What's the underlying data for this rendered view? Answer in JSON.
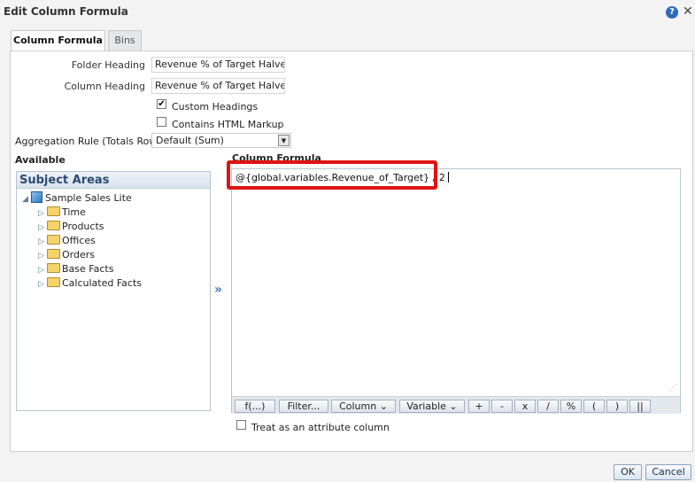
{
  "dialog": {
    "title": "Edit Column Formula"
  },
  "icons": {
    "help": "?",
    "close": "✕"
  },
  "tabs": [
    {
      "label": "Column Formula",
      "active": true
    },
    {
      "label": "Bins",
      "active": false
    }
  ],
  "form": {
    "folder_heading_label": "Folder Heading",
    "folder_heading_value": "Revenue % of Target Halved",
    "column_heading_label": "Column Heading",
    "column_heading_value": "Revenue % of Target Halved",
    "custom_headings_label": "Custom Headings",
    "custom_headings_checked": true,
    "contains_html_label": "Contains HTML Markup",
    "contains_html_checked": false,
    "aggregation_label": "Aggregation Rule (Totals Row)",
    "aggregation_value": "Default (Sum)"
  },
  "available": {
    "section_label": "Available",
    "panel_title": "Subject Areas",
    "root": "Sample Sales Lite",
    "folders": [
      "Time",
      "Products",
      "Offices",
      "Orders",
      "Base Facts",
      "Calculated Facts"
    ]
  },
  "formula": {
    "section_label": "Column Formula",
    "text": "@{global.variables.Revenue_of_Target} / 2",
    "toolbar": {
      "fx": "f(...)",
      "filter": "Filter...",
      "column": "Column ⌄",
      "variable": "Variable ⌄",
      "plus": "+",
      "minus": "-",
      "times": "x",
      "divide": "/",
      "percent": "%",
      "lparen": "(",
      "rparen": ")",
      "concat": "||"
    }
  },
  "attribute": {
    "label": "Treat as an attribute column",
    "checked": false
  },
  "buttons": {
    "ok": "OK",
    "cancel": "Cancel"
  },
  "colors": {
    "highlight": "#e01313",
    "accent": "#2b4a73"
  }
}
